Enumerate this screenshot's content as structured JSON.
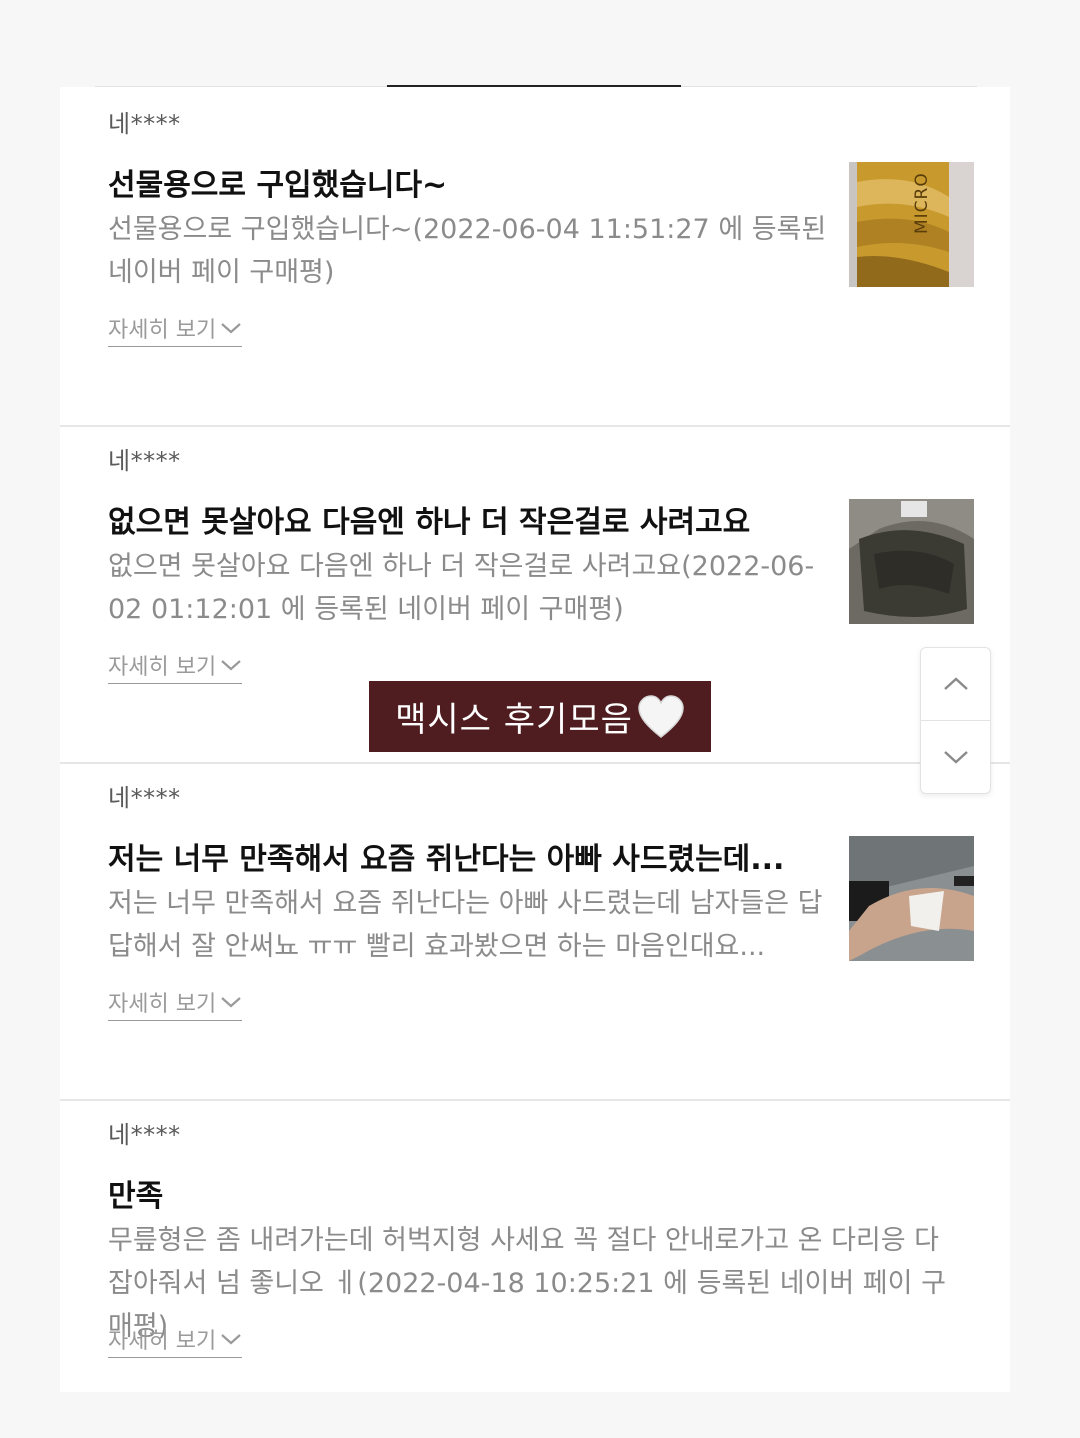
{
  "reviews": [
    {
      "author": "네****",
      "title": "선물용으로 구입했습니다~",
      "body": "선물용으로 구입했습니다~(2022-06-04 11:51:27 에 등록된 네이버 페이 구매평)",
      "more_label": "자세히 보기",
      "thumb_text": "MICRO"
    },
    {
      "author": "네****",
      "title": "없으면 못살아요 다음엔 하나 더 작은걸로 사려고요",
      "body": "없으면 못살아요 다음엔 하나 더 작은걸로 사려고요(2022-06-02 01:12:01 에 등록된 네이버 페이 구매평)",
      "more_label": "자세히 보기"
    },
    {
      "author": "네****",
      "title": "저는 너무 만족해서 요즘 쥐난다는 아빠 사드렸는데...",
      "body": "저는 너무 만족해서 요즘 쥐난다는 아빠 사드렸는데 남자들은 답답해서 잘 안써뇨 ㅠㅠ 빨리 효과봤으면 하는 마음인대요...",
      "more_label": "자세히 보기"
    },
    {
      "author": "네****",
      "title": "만족",
      "body": "무릎형은 좀 내려가는데 허벅지형 사세요 꼭 절다 안내로가고 온 다리응 다 잡아줘서 넘 좋니오 ㅔ(2022-04-18 10:25:21 에 등록된 네이버 페이 구매평)",
      "more_label": "자세히 보기"
    }
  ],
  "caption": {
    "text": "맥시스 후기모음",
    "emoji": "heart-icon"
  },
  "scroll": {
    "up_icon": "chevron-up-icon",
    "down_icon": "chevron-down-icon"
  },
  "colors": {
    "caption_bg": "#4f1d20",
    "title": "#111111",
    "body": "#8b8b8b",
    "author": "#5a5a5a"
  }
}
